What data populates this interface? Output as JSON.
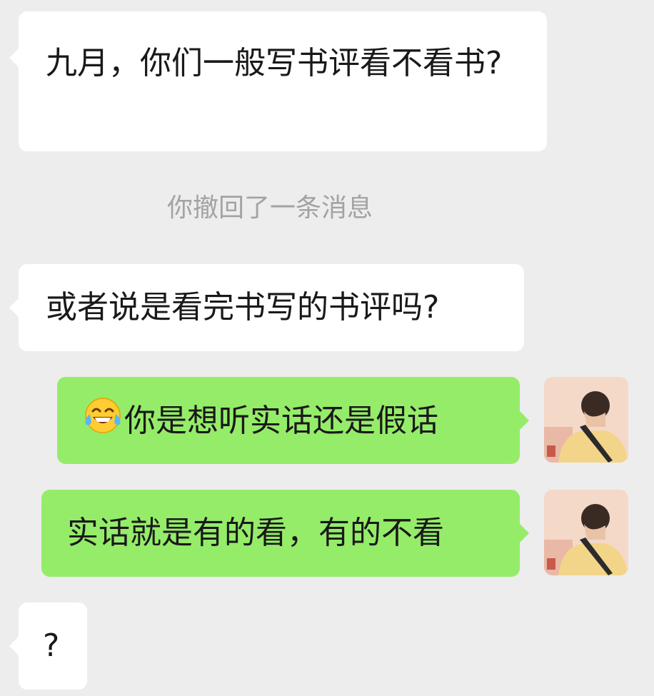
{
  "chat": {
    "messages": [
      {
        "side": "incoming",
        "text": "九月，你们一般写书评看不看书?"
      },
      {
        "side": "incoming",
        "text": "或者说是看完书写的书评吗?"
      },
      {
        "side": "outgoing",
        "emoji": "face-with-tears-of-joy",
        "text": "你是想听实话还是假话"
      },
      {
        "side": "outgoing",
        "text": "实话就是有的看，有的不看"
      },
      {
        "side": "incoming",
        "text": "?"
      }
    ],
    "system_notice": "你撤回了一条消息"
  },
  "colors": {
    "background": "#ededed",
    "incoming_bubble": "#ffffff",
    "outgoing_bubble": "#95ec69",
    "system_text": "#a3a3a3",
    "text": "#191919"
  }
}
